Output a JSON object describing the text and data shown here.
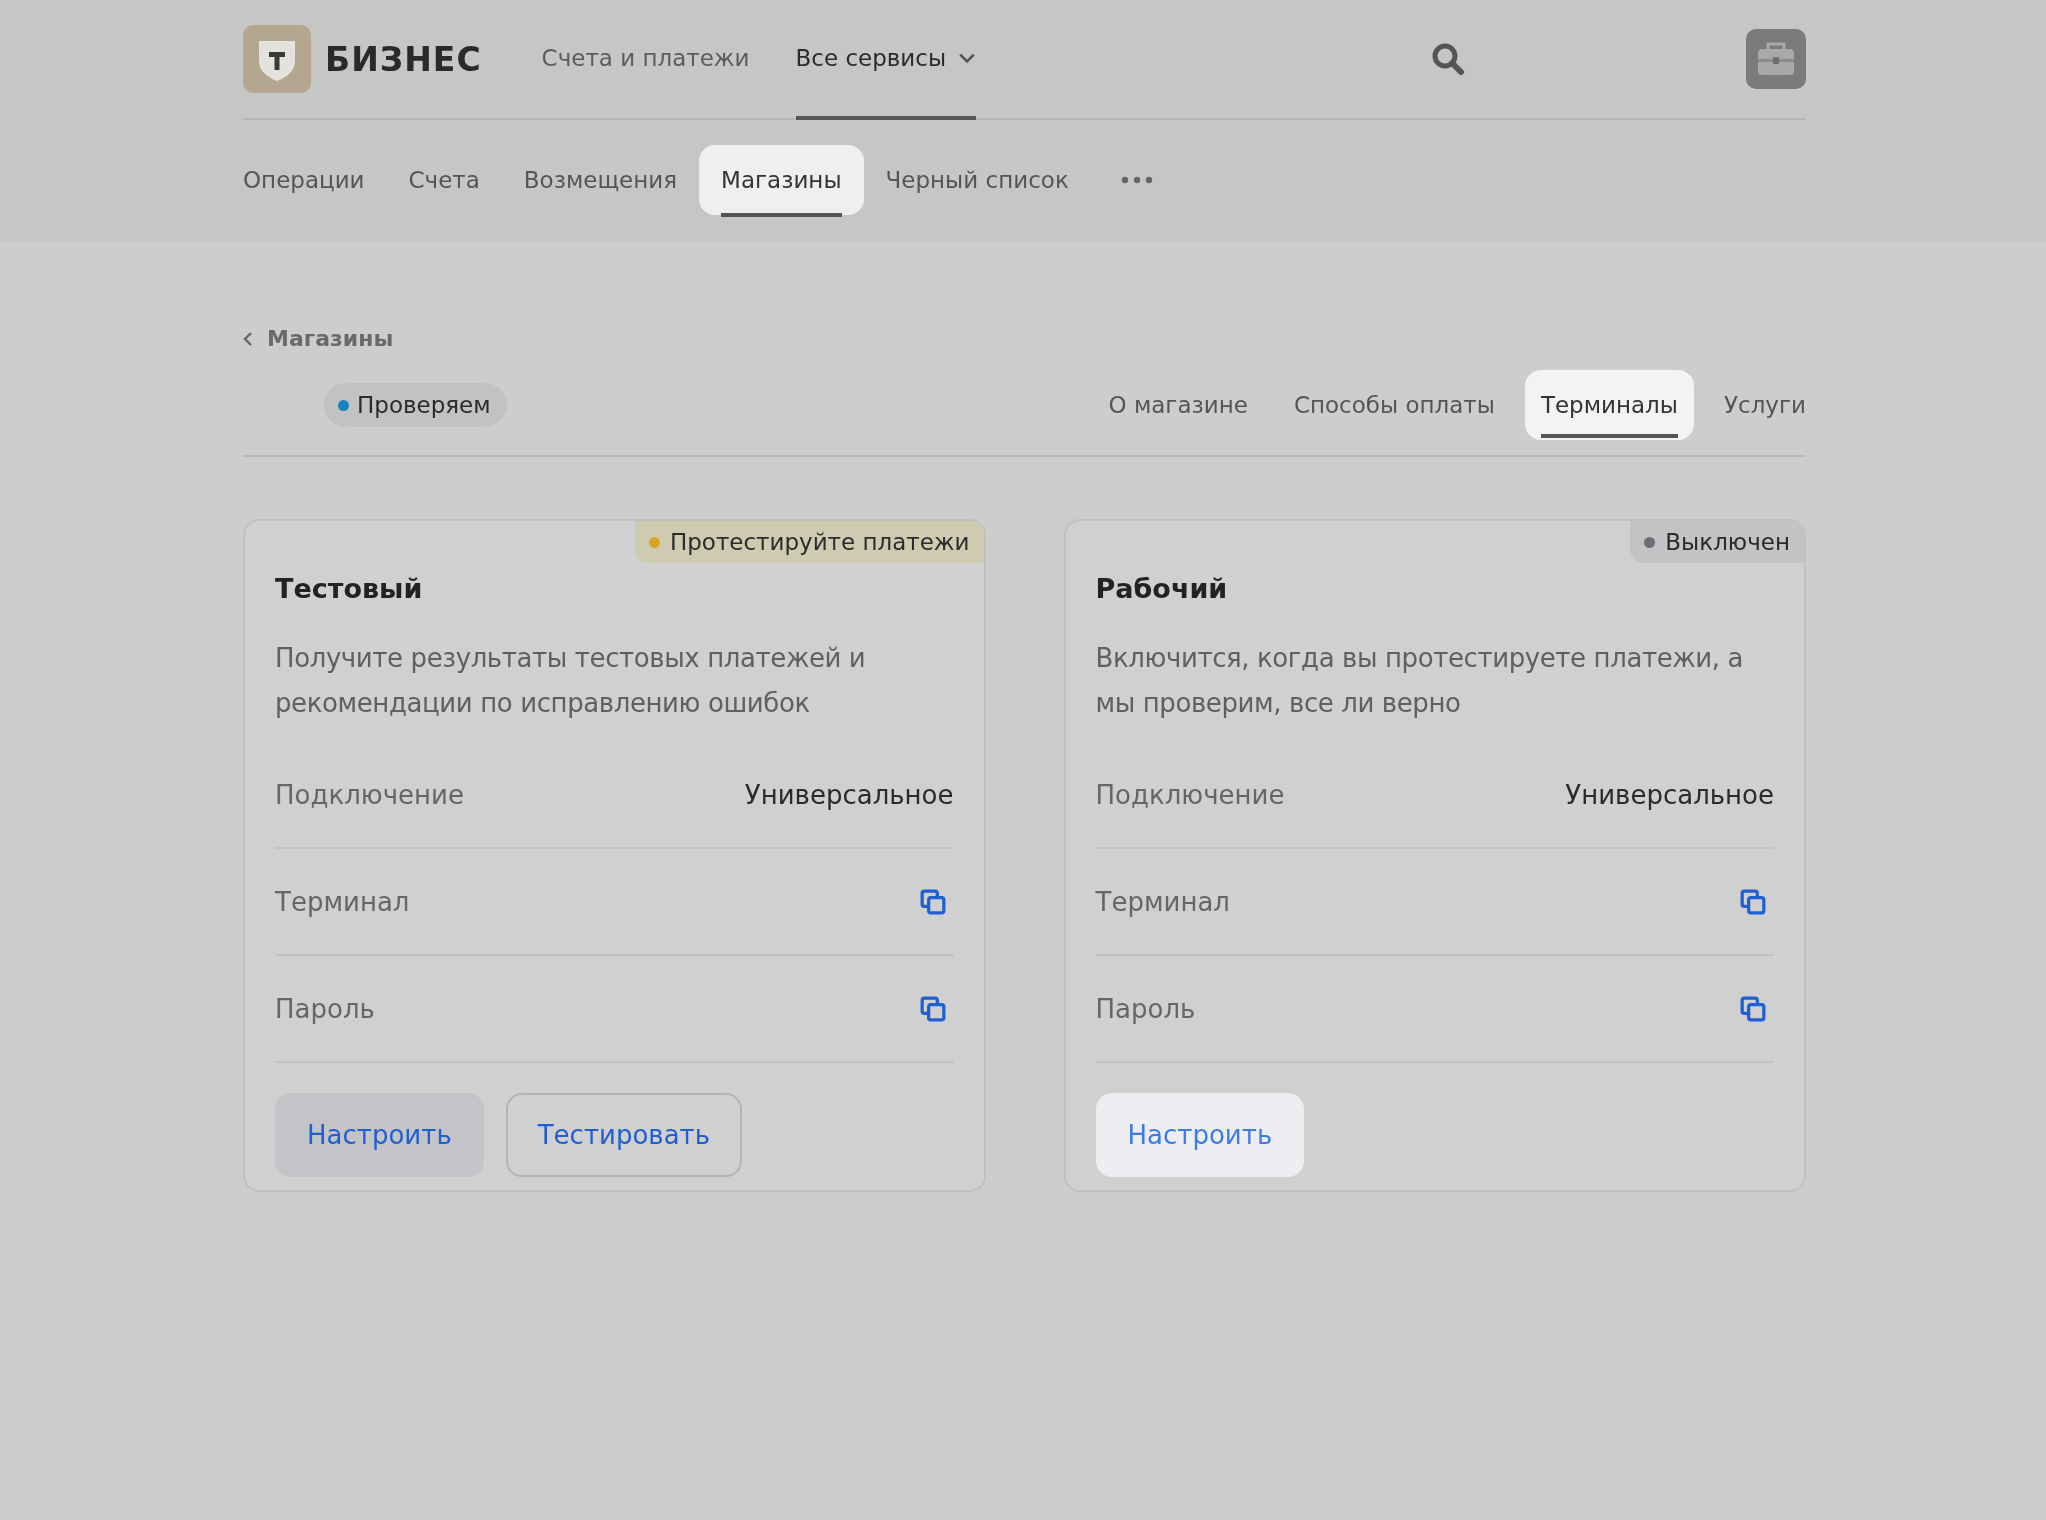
{
  "header": {
    "logo": {
      "text": "БИЗНЕС"
    },
    "nav": [
      {
        "label": "Счета и платежи",
        "selected": false,
        "dropdown": false
      },
      {
        "label": "Все сервисы",
        "selected": true,
        "dropdown": true
      }
    ]
  },
  "section_tabs": [
    {
      "label": "Операции",
      "selected": false
    },
    {
      "label": "Счета",
      "selected": false
    },
    {
      "label": "Возмещения",
      "selected": false
    },
    {
      "label": "Магазины",
      "selected": true
    },
    {
      "label": "Черный список",
      "selected": false
    }
  ],
  "breadcrumb": {
    "label": "Магазины"
  },
  "store": {
    "status": {
      "label": "Проверяем",
      "color": "#1a7fc0"
    },
    "tabs": [
      {
        "label": "О магазине",
        "selected": false
      },
      {
        "label": "Способы оплаты",
        "selected": false
      },
      {
        "label": "Терминалы",
        "selected": true
      },
      {
        "label": "Услуги",
        "selected": false
      }
    ]
  },
  "terminals": [
    {
      "title": "Тестовый",
      "badge": {
        "label": "Протестируйте платежи",
        "kind": "warning",
        "color": "#d6a623"
      },
      "description": "Получите результаты тестовых платежей и рекомендации по исправлению ошибок",
      "rows": [
        {
          "kind": "text",
          "label": "Подключение",
          "value": "Универсальное"
        },
        {
          "kind": "copy",
          "label": "Терминал"
        },
        {
          "kind": "copy",
          "label": "Пароль"
        }
      ],
      "buttons": [
        {
          "label": "Настроить",
          "kind": "filled"
        },
        {
          "label": "Тестировать",
          "kind": "outlined"
        }
      ]
    },
    {
      "title": "Рабочий",
      "badge": {
        "label": "Выключен",
        "kind": "neutral",
        "color": "#6b6e72"
      },
      "description": "Включится, когда вы протестируете платежи, а мы проверим, все ли верно",
      "rows": [
        {
          "kind": "text",
          "label": "Подключение",
          "value": "Универсальное"
        },
        {
          "kind": "copy",
          "label": "Терминал"
        },
        {
          "kind": "copy",
          "label": "Пароль"
        }
      ],
      "buttons": [
        {
          "label": "Настроить",
          "kind": "light"
        }
      ]
    }
  ]
}
